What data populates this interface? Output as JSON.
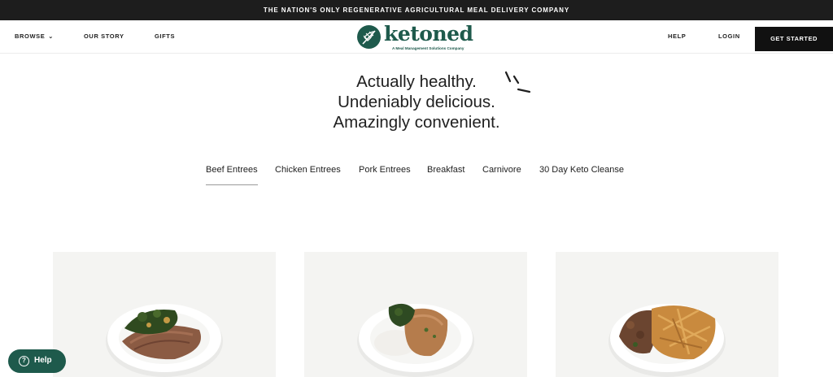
{
  "announcement": "THE NATION'S ONLY REGENERATIVE AGRICULTURAL MEAL DELIVERY COMPANY",
  "nav": {
    "browse": "BROWSE",
    "our_story": "OUR STORY",
    "gifts": "GIFTS",
    "help": "HELP",
    "login": "LOGIN",
    "get_started": "GET STARTED"
  },
  "logo": {
    "wordmark": "ketoned",
    "tagline": "A Meal Management Solutions Company"
  },
  "hero": {
    "line1": "Actually healthy.",
    "line2": "Undeniably delicious.",
    "line3": "Amazingly convenient."
  },
  "tabs": [
    "Beef Entrees",
    "Chicken Entrees",
    "Pork Entrees",
    "Breakfast",
    "Carnivore",
    "30 Day Keto Cleanse"
  ],
  "active_tab": "Beef Entrees",
  "help_button": "Help",
  "colors": {
    "brand": "#1e5a4c",
    "dark": "#1d1d1d",
    "card_bg": "#f4f4f2"
  }
}
